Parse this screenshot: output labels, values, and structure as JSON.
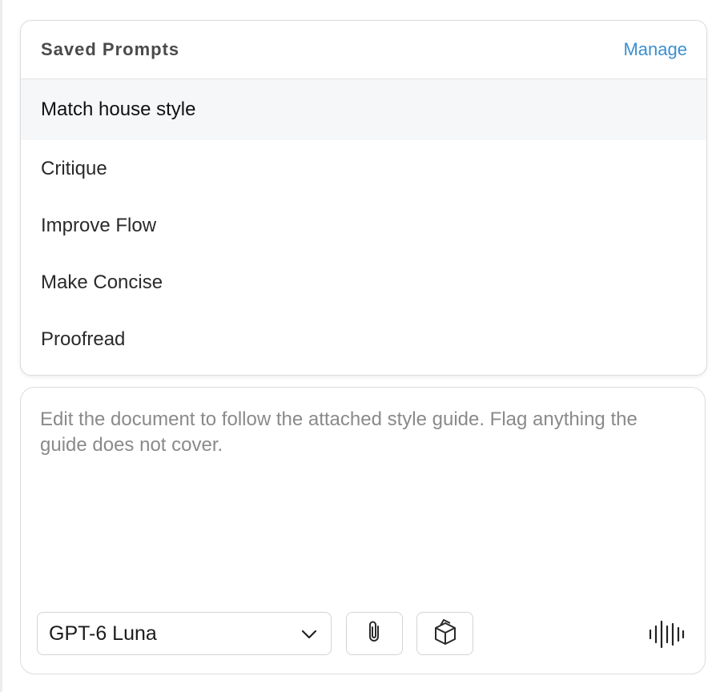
{
  "saved_prompts": {
    "title": "Saved Prompts",
    "manage_label": "Manage",
    "items": [
      {
        "label": "Match house style",
        "selected": true
      },
      {
        "label": "Critique",
        "selected": false
      },
      {
        "label": "Improve Flow",
        "selected": false
      },
      {
        "label": "Make Concise",
        "selected": false
      },
      {
        "label": "Proofread",
        "selected": false
      }
    ]
  },
  "composer": {
    "text": "Edit the document to follow the attached style guide. Flag anything the guide does not cover.",
    "model": {
      "selected": "GPT-6 Luna",
      "icon": "chevron-down-icon"
    },
    "tools": [
      {
        "name": "attach",
        "icon": "paperclip-icon"
      },
      {
        "name": "plugins",
        "icon": "cube-icon"
      },
      {
        "name": "voice",
        "icon": "waveform-icon"
      }
    ]
  },
  "colors": {
    "accent": "#3a8fd0",
    "selected_row": "#f6f7f9",
    "border": "#dcdcdc",
    "placeholder_text": "#8a8a8a"
  }
}
